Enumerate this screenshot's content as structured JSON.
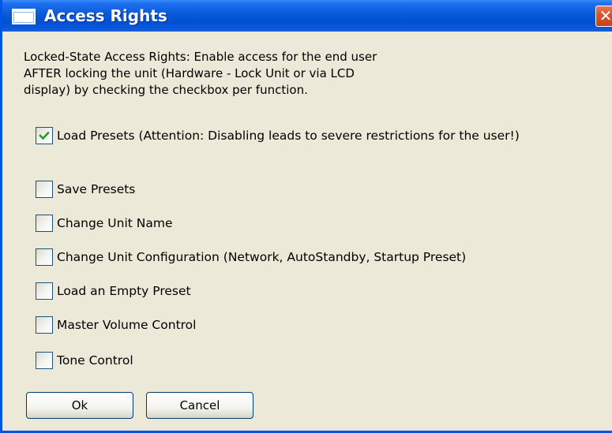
{
  "window": {
    "title": "Access Rights",
    "close_glyph": "✕",
    "accent_color": "#0054e3"
  },
  "description": {
    "lines": [
      "Locked-State Access Rights: Enable access for the end user",
      "AFTER locking the unit (Hardware - Lock Unit or via LCD",
      "display) by checking the checkbox per function."
    ]
  },
  "options": [
    {
      "label": "Load Presets (Attention: Disabling leads to severe restrictions for the user!)",
      "checked": true
    },
    {
      "label": "Save Presets",
      "checked": false
    },
    {
      "label": "Change Unit Name",
      "checked": false
    },
    {
      "label": "Change Unit Configuration (Network, AutoStandby, Startup Preset)",
      "checked": false
    },
    {
      "label": "Load an Empty Preset",
      "checked": false
    },
    {
      "label": "Master Volume Control",
      "checked": false
    },
    {
      "label": "Tone Control",
      "checked": false
    }
  ],
  "buttons": {
    "ok_label": "Ok",
    "cancel_label": "Cancel"
  },
  "icons": {
    "window": "window-icon",
    "close": "close-icon",
    "check": "checkmark-icon"
  }
}
